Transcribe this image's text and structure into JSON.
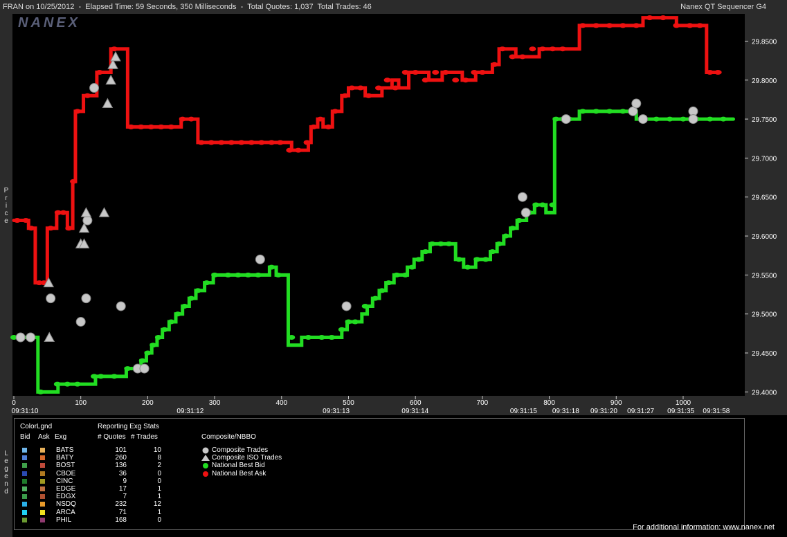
{
  "header": {
    "title": "FRAN on 10/25/2012  -  Elapsed Time: 59 Seconds, 350 Milliseconds  -  Total Quotes: 1,037  Total Trades: 46",
    "app_name": "Nanex QT Sequencer G4"
  },
  "logo_text": "NANEX",
  "side_labels": {
    "price": "Price",
    "legend": "Legend"
  },
  "chart_data": {
    "type": "line",
    "ylim": [
      29.395,
      29.885
    ],
    "xlim": [
      0,
      1090
    ],
    "y_ticks": [
      "29.8500",
      "29.8000",
      "29.7500",
      "29.7000",
      "29.6500",
      "29.6000",
      "29.5500",
      "29.5000",
      "29.4500",
      "29.4000"
    ],
    "x_ticks": [
      "0",
      "100",
      "200",
      "300",
      "400",
      "500",
      "600",
      "700",
      "800",
      "900",
      "1000"
    ],
    "time_labels": [
      {
        "x": 0,
        "label": "09:31:10"
      },
      {
        "x": 247,
        "label": "09:31:12"
      },
      {
        "x": 465,
        "label": "09:31:13"
      },
      {
        "x": 583,
        "label": "09:31:14"
      },
      {
        "x": 745,
        "label": "09:31:15"
      },
      {
        "x": 808,
        "label": "09:31:18"
      },
      {
        "x": 865,
        "label": "09:31:20"
      },
      {
        "x": 920,
        "label": "09:31:27"
      },
      {
        "x": 980,
        "label": "09:31:35"
      },
      {
        "x": 1033,
        "label": "09:31:58"
      }
    ],
    "series": [
      {
        "name": "National Best Bid",
        "color": "#22dd22",
        "step": [
          [
            0,
            29.47
          ],
          [
            35,
            29.47
          ],
          [
            36,
            29.4
          ],
          [
            55,
            29.4
          ],
          [
            66,
            29.41
          ],
          [
            110,
            29.41
          ],
          [
            122,
            29.42
          ],
          [
            160,
            29.42
          ],
          [
            168,
            29.43
          ],
          [
            185,
            29.43
          ],
          [
            190,
            29.44
          ],
          [
            198,
            29.45
          ],
          [
            206,
            29.46
          ],
          [
            214,
            29.47
          ],
          [
            222,
            29.48
          ],
          [
            232,
            29.49
          ],
          [
            242,
            29.5
          ],
          [
            252,
            29.51
          ],
          [
            262,
            29.52
          ],
          [
            272,
            29.53
          ],
          [
            285,
            29.54
          ],
          [
            298,
            29.55
          ],
          [
            314,
            29.55
          ],
          [
            340,
            29.55
          ],
          [
            358,
            29.55
          ],
          [
            382,
            29.56
          ],
          [
            392,
            29.55
          ],
          [
            400,
            29.55
          ],
          [
            410,
            29.46
          ],
          [
            430,
            29.47
          ],
          [
            480,
            29.47
          ],
          [
            490,
            29.48
          ],
          [
            498,
            29.49
          ],
          [
            520,
            29.5
          ],
          [
            528,
            29.51
          ],
          [
            536,
            29.52
          ],
          [
            546,
            29.53
          ],
          [
            556,
            29.54
          ],
          [
            568,
            29.55
          ],
          [
            588,
            29.56
          ],
          [
            598,
            29.57
          ],
          [
            610,
            29.58
          ],
          [
            622,
            29.59
          ],
          [
            640,
            29.59
          ],
          [
            660,
            29.57
          ],
          [
            672,
            29.56
          ],
          [
            690,
            29.57
          ],
          [
            712,
            29.58
          ],
          [
            722,
            29.59
          ],
          [
            732,
            29.6
          ],
          [
            742,
            29.61
          ],
          [
            752,
            29.62
          ],
          [
            766,
            29.63
          ],
          [
            778,
            29.64
          ],
          [
            795,
            29.63
          ],
          [
            808,
            29.75
          ],
          [
            838,
            29.75
          ],
          [
            845,
            29.76
          ],
          [
            922,
            29.76
          ],
          [
            930,
            29.75
          ],
          [
            1075,
            29.75
          ]
        ]
      },
      {
        "name": "National Best Ask",
        "color": "#ee1111",
        "step": [
          [
            0,
            29.62
          ],
          [
            20,
            29.62
          ],
          [
            22,
            29.61
          ],
          [
            30,
            29.61
          ],
          [
            32,
            29.54
          ],
          [
            48,
            29.54
          ],
          [
            50,
            29.61
          ],
          [
            62,
            29.61
          ],
          [
            64,
            29.63
          ],
          [
            78,
            29.63
          ],
          [
            80,
            29.61
          ],
          [
            86,
            29.61
          ],
          [
            88,
            29.67
          ],
          [
            90,
            29.67
          ],
          [
            92,
            29.76
          ],
          [
            102,
            29.76
          ],
          [
            104,
            29.78
          ],
          [
            120,
            29.78
          ],
          [
            124,
            29.81
          ],
          [
            140,
            29.81
          ],
          [
            145,
            29.84
          ],
          [
            165,
            29.84
          ],
          [
            170,
            29.74
          ],
          [
            245,
            29.74
          ],
          [
            250,
            29.75
          ],
          [
            270,
            29.75
          ],
          [
            275,
            29.72
          ],
          [
            410,
            29.72
          ],
          [
            415,
            29.71
          ],
          [
            430,
            29.71
          ],
          [
            440,
            29.72
          ],
          [
            444,
            29.74
          ],
          [
            454,
            29.75
          ],
          [
            462,
            29.74
          ],
          [
            476,
            29.76
          ],
          [
            490,
            29.78
          ],
          [
            500,
            29.79
          ],
          [
            512,
            29.79
          ],
          [
            525,
            29.78
          ],
          [
            550,
            29.79
          ],
          [
            565,
            29.8
          ],
          [
            575,
            29.79
          ],
          [
            590,
            29.81
          ],
          [
            610,
            29.81
          ],
          [
            620,
            29.8
          ],
          [
            640,
            29.81
          ],
          [
            670,
            29.8
          ],
          [
            690,
            29.81
          ],
          [
            715,
            29.82
          ],
          [
            725,
            29.84
          ],
          [
            750,
            29.83
          ],
          [
            785,
            29.84
          ],
          [
            840,
            29.84
          ],
          [
            845,
            29.87
          ],
          [
            935,
            29.87
          ],
          [
            940,
            29.88
          ],
          [
            985,
            29.88
          ],
          [
            990,
            29.87
          ],
          [
            1030,
            29.87
          ],
          [
            1035,
            29.81
          ],
          [
            1055,
            29.81
          ]
        ]
      }
    ],
    "bid_markers": [
      [
        0,
        29.47
      ],
      [
        10,
        29.47
      ],
      [
        40,
        29.4
      ],
      [
        65,
        29.41
      ],
      [
        80,
        29.41
      ],
      [
        95,
        29.41
      ],
      [
        120,
        29.42
      ],
      [
        130,
        29.42
      ],
      [
        150,
        29.42
      ],
      [
        170,
        29.43
      ],
      [
        192,
        29.44
      ],
      [
        200,
        29.45
      ],
      [
        208,
        29.46
      ],
      [
        216,
        29.47
      ],
      [
        225,
        29.48
      ],
      [
        235,
        29.49
      ],
      [
        245,
        29.5
      ],
      [
        255,
        29.51
      ],
      [
        265,
        29.52
      ],
      [
        275,
        29.53
      ],
      [
        288,
        29.54
      ],
      [
        300,
        29.55
      ],
      [
        320,
        29.55
      ],
      [
        335,
        29.55
      ],
      [
        350,
        29.55
      ],
      [
        365,
        29.55
      ],
      [
        385,
        29.56
      ],
      [
        395,
        29.55
      ],
      [
        415,
        29.47
      ],
      [
        440,
        29.47
      ],
      [
        460,
        29.47
      ],
      [
        475,
        29.47
      ],
      [
        490,
        29.48
      ],
      [
        500,
        29.49
      ],
      [
        510,
        29.49
      ],
      [
        525,
        29.51
      ],
      [
        540,
        29.52
      ],
      [
        550,
        29.53
      ],
      [
        560,
        29.54
      ],
      [
        572,
        29.55
      ],
      [
        585,
        29.55
      ],
      [
        595,
        29.56
      ],
      [
        605,
        29.57
      ],
      [
        615,
        29.58
      ],
      [
        625,
        29.59
      ],
      [
        638,
        29.59
      ],
      [
        650,
        29.59
      ],
      [
        665,
        29.57
      ],
      [
        678,
        29.56
      ],
      [
        692,
        29.57
      ],
      [
        705,
        29.57
      ],
      [
        715,
        29.58
      ],
      [
        725,
        29.59
      ],
      [
        735,
        29.6
      ],
      [
        745,
        29.61
      ],
      [
        755,
        29.62
      ],
      [
        770,
        29.63
      ],
      [
        780,
        29.64
      ],
      [
        790,
        29.64
      ],
      [
        805,
        29.64
      ],
      [
        810,
        29.75
      ],
      [
        820,
        29.75
      ],
      [
        830,
        29.75
      ],
      [
        850,
        29.76
      ],
      [
        870,
        29.76
      ],
      [
        890,
        29.76
      ],
      [
        910,
        29.76
      ],
      [
        940,
        29.75
      ],
      [
        960,
        29.75
      ],
      [
        980,
        29.75
      ],
      [
        1000,
        29.75
      ],
      [
        1020,
        29.75
      ],
      [
        1040,
        29.75
      ],
      [
        1060,
        29.75
      ]
    ],
    "ask_markers": [
      [
        5,
        29.62
      ],
      [
        18,
        29.62
      ],
      [
        26,
        29.61
      ],
      [
        38,
        29.54
      ],
      [
        45,
        29.54
      ],
      [
        55,
        29.61
      ],
      [
        66,
        29.63
      ],
      [
        74,
        29.63
      ],
      [
        82,
        29.61
      ],
      [
        89,
        29.67
      ],
      [
        95,
        29.76
      ],
      [
        110,
        29.78
      ],
      [
        128,
        29.81
      ],
      [
        150,
        29.84
      ],
      [
        175,
        29.74
      ],
      [
        190,
        29.74
      ],
      [
        205,
        29.74
      ],
      [
        220,
        29.74
      ],
      [
        235,
        29.74
      ],
      [
        252,
        29.75
      ],
      [
        265,
        29.75
      ],
      [
        280,
        29.72
      ],
      [
        295,
        29.72
      ],
      [
        310,
        29.72
      ],
      [
        325,
        29.72
      ],
      [
        340,
        29.72
      ],
      [
        355,
        29.72
      ],
      [
        370,
        29.72
      ],
      [
        385,
        29.72
      ],
      [
        398,
        29.72
      ],
      [
        412,
        29.71
      ],
      [
        425,
        29.71
      ],
      [
        438,
        29.72
      ],
      [
        448,
        29.74
      ],
      [
        458,
        29.75
      ],
      [
        470,
        29.74
      ],
      [
        480,
        29.76
      ],
      [
        495,
        29.78
      ],
      [
        505,
        29.79
      ],
      [
        518,
        29.79
      ],
      [
        530,
        29.78
      ],
      [
        545,
        29.79
      ],
      [
        558,
        29.8
      ],
      [
        570,
        29.79
      ],
      [
        585,
        29.81
      ],
      [
        600,
        29.81
      ],
      [
        615,
        29.8
      ],
      [
        630,
        29.81
      ],
      [
        645,
        29.81
      ],
      [
        660,
        29.8
      ],
      [
        675,
        29.8
      ],
      [
        688,
        29.81
      ],
      [
        700,
        29.81
      ],
      [
        718,
        29.82
      ],
      [
        730,
        29.84
      ],
      [
        745,
        29.83
      ],
      [
        760,
        29.83
      ],
      [
        775,
        29.84
      ],
      [
        790,
        29.84
      ],
      [
        805,
        29.84
      ],
      [
        820,
        29.84
      ],
      [
        850,
        29.87
      ],
      [
        870,
        29.87
      ],
      [
        890,
        29.87
      ],
      [
        910,
        29.87
      ],
      [
        930,
        29.87
      ],
      [
        950,
        29.88
      ],
      [
        970,
        29.88
      ],
      [
        990,
        29.87
      ],
      [
        1010,
        29.87
      ],
      [
        1025,
        29.87
      ],
      [
        1040,
        29.81
      ],
      [
        1052,
        29.81
      ]
    ],
    "composite_trades": [
      [
        10,
        29.47
      ],
      [
        25,
        29.47
      ],
      [
        55,
        29.52
      ],
      [
        100,
        29.49
      ],
      [
        108,
        29.52
      ],
      [
        110,
        29.62
      ],
      [
        120,
        29.79
      ],
      [
        160,
        29.51
      ],
      [
        185,
        29.43
      ],
      [
        195,
        29.43
      ],
      [
        368,
        29.57
      ],
      [
        497,
        29.51
      ],
      [
        760,
        29.65
      ],
      [
        765,
        29.63
      ],
      [
        825,
        29.75
      ],
      [
        925,
        29.76
      ],
      [
        930,
        29.77
      ],
      [
        940,
        29.75
      ],
      [
        1015,
        29.76
      ],
      [
        1015,
        29.75
      ]
    ],
    "iso_trades": [
      [
        52,
        29.54
      ],
      [
        53,
        29.47
      ],
      [
        100,
        29.59
      ],
      [
        105,
        29.59
      ],
      [
        105,
        29.61
      ],
      [
        108,
        29.63
      ],
      [
        135,
        29.63
      ],
      [
        140,
        29.77
      ],
      [
        145,
        29.8
      ],
      [
        148,
        29.82
      ],
      [
        152,
        29.83
      ]
    ]
  },
  "legend": {
    "color_legend_title": "ColorLgnd",
    "col_bid": "Bid",
    "col_ask": "Ask",
    "col_exg": "Exg",
    "stats_title": "Reporting Exg Stats",
    "col_quotes": "# Quotes",
    "col_trades": "# Trades",
    "composite_title": "Composite/NBBO",
    "exchanges": [
      {
        "exg": "BATS",
        "quotes": "101",
        "trades": "10",
        "bid_color": "#6fb6ea",
        "ask_color": "#e8b15a"
      },
      {
        "exg": "BATY",
        "quotes": "260",
        "trades": "8",
        "bid_color": "#4f7fd6",
        "ask_color": "#d86a2a"
      },
      {
        "exg": "BOST",
        "quotes": "136",
        "trades": "2",
        "bid_color": "#3fa04a",
        "ask_color": "#c04a3a"
      },
      {
        "exg": "CBOE",
        "quotes": "36",
        "trades": "0",
        "bid_color": "#2a4ab0",
        "ask_color": "#b07a20"
      },
      {
        "exg": "CINC",
        "quotes": "9",
        "trades": "0",
        "bid_color": "#1e7a2a",
        "ask_color": "#a09a20"
      },
      {
        "exg": "EDGE",
        "quotes": "17",
        "trades": "1",
        "bid_color": "#4fb060",
        "ask_color": "#c07040"
      },
      {
        "exg": "EDGX",
        "quotes": "7",
        "trades": "1",
        "bid_color": "#3a9a4a",
        "ask_color": "#b05030"
      },
      {
        "exg": "NSDQ",
        "quotes": "232",
        "trades": "12",
        "bid_color": "#2ab0e8",
        "ask_color": "#e89a2a"
      },
      {
        "exg": "ARCA",
        "quotes": "71",
        "trades": "1",
        "bid_color": "#20d0f0",
        "ask_color": "#f0e020"
      },
      {
        "exg": "PHIL",
        "quotes": "168",
        "trades": "0",
        "bid_color": "#6a9a30",
        "ask_color": "#903a70"
      }
    ],
    "symbols": [
      {
        "label": "Composite Trades",
        "color": "#c8c8c8",
        "icon": "hexagon-icon"
      },
      {
        "label": "Composite ISO Trades",
        "color": "#c8c8c8",
        "icon": "triangle-icon"
      },
      {
        "label": "National Best Bid",
        "color": "#22dd22",
        "icon": "circle-icon"
      },
      {
        "label": "National Best Ask",
        "color": "#ee1111",
        "icon": "circle-icon"
      }
    ]
  },
  "footer": "For additional information: www.nanex.net"
}
